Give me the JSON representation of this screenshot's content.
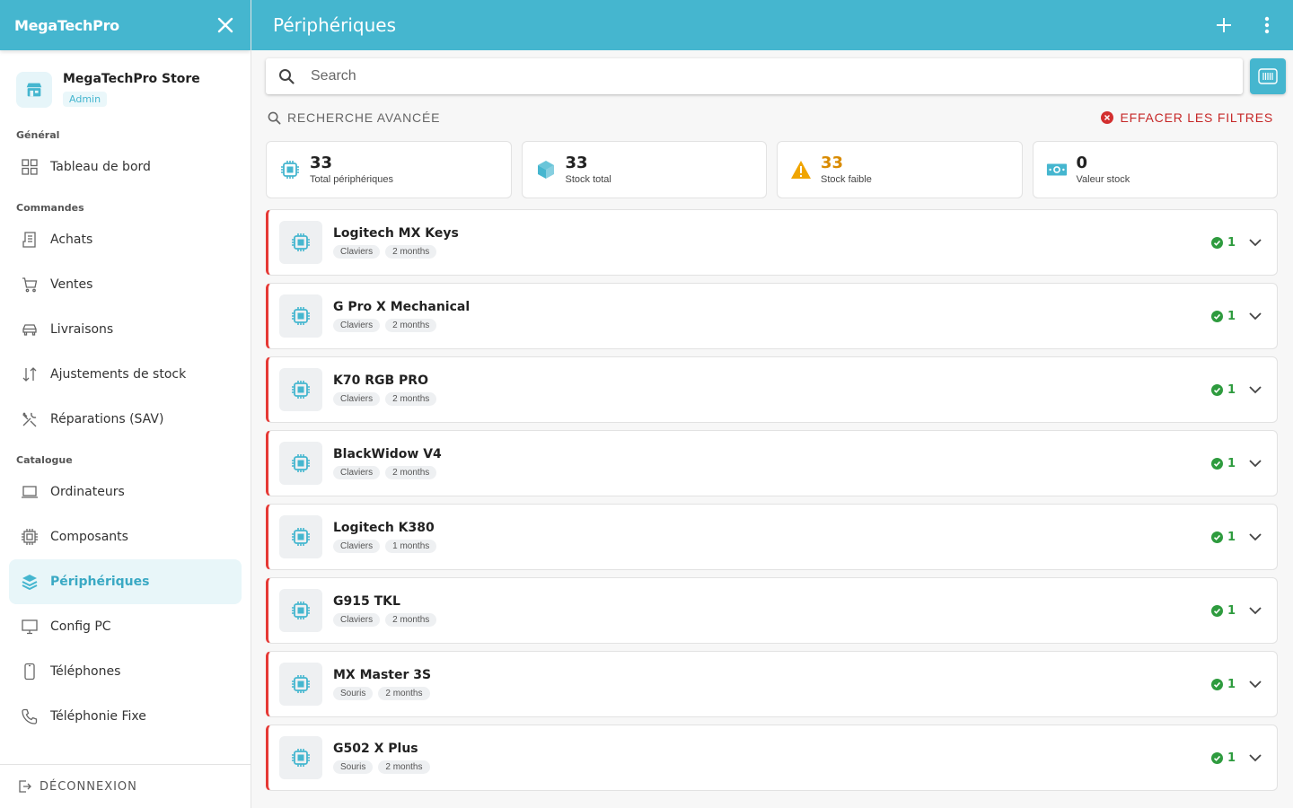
{
  "sidebar": {
    "brand": "MegaTechPro",
    "store": {
      "name": "MegaTechPro Store",
      "role": "Admin"
    },
    "sections": [
      {
        "title": "Général",
        "items": [
          {
            "label": "Tableau de bord",
            "icon": "dashboard-icon"
          }
        ]
      },
      {
        "title": "Commandes",
        "items": [
          {
            "label": "Achats",
            "icon": "receipt-icon"
          },
          {
            "label": "Ventes",
            "icon": "cart-icon"
          },
          {
            "label": "Livraisons",
            "icon": "car-icon"
          },
          {
            "label": "Ajustements de stock",
            "icon": "swap-icon"
          },
          {
            "label": "Réparations (SAV)",
            "icon": "tools-icon"
          }
        ]
      },
      {
        "title": "Catalogue",
        "items": [
          {
            "label": "Ordinateurs",
            "icon": "laptop-icon"
          },
          {
            "label": "Composants",
            "icon": "chip-icon"
          },
          {
            "label": "Périphériques",
            "icon": "layers-icon",
            "active": true
          },
          {
            "label": "Config PC",
            "icon": "monitor-icon"
          },
          {
            "label": "Téléphones",
            "icon": "phone-icon"
          },
          {
            "label": "Téléphonie Fixe",
            "icon": "landline-icon"
          }
        ]
      }
    ],
    "logout": "DÉCONNEXION"
  },
  "header": {
    "title": "Périphériques"
  },
  "search": {
    "placeholder": "Search",
    "value": ""
  },
  "filters": {
    "advanced": "RECHERCHE AVANCÉE",
    "clear": "EFFACER LES FILTRES"
  },
  "stats": [
    {
      "value": "33",
      "label": "Total périphériques",
      "icon": "chip-icon",
      "color": "#45b6cf"
    },
    {
      "value": "33",
      "label": "Stock total",
      "icon": "cube-icon",
      "color": "#45b6cf"
    },
    {
      "value": "33",
      "label": "Stock faible",
      "icon": "warning-icon",
      "color": "#f0a500"
    },
    {
      "value": "0",
      "label": "Valeur stock",
      "icon": "money-icon",
      "color": "#45b6cf"
    }
  ],
  "items": [
    {
      "name": "Logitech MX Keys",
      "category": "Claviers",
      "age": "2 months",
      "stock": "1"
    },
    {
      "name": "G Pro X Mechanical",
      "category": "Claviers",
      "age": "2 months",
      "stock": "1"
    },
    {
      "name": "K70 RGB PRO",
      "category": "Claviers",
      "age": "2 months",
      "stock": "1"
    },
    {
      "name": "BlackWidow V4",
      "category": "Claviers",
      "age": "2 months",
      "stock": "1"
    },
    {
      "name": "Logitech K380",
      "category": "Claviers",
      "age": "1 months",
      "stock": "1"
    },
    {
      "name": "G915 TKL",
      "category": "Claviers",
      "age": "2 months",
      "stock": "1"
    },
    {
      "name": "MX Master 3S",
      "category": "Souris",
      "age": "2 months",
      "stock": "1"
    },
    {
      "name": "G502 X Plus",
      "category": "Souris",
      "age": "2 months",
      "stock": "1"
    }
  ],
  "colors": {
    "accent": "#45b6cf",
    "danger": "#e53935",
    "success": "#2e9b3e",
    "warning": "#d98b00"
  }
}
